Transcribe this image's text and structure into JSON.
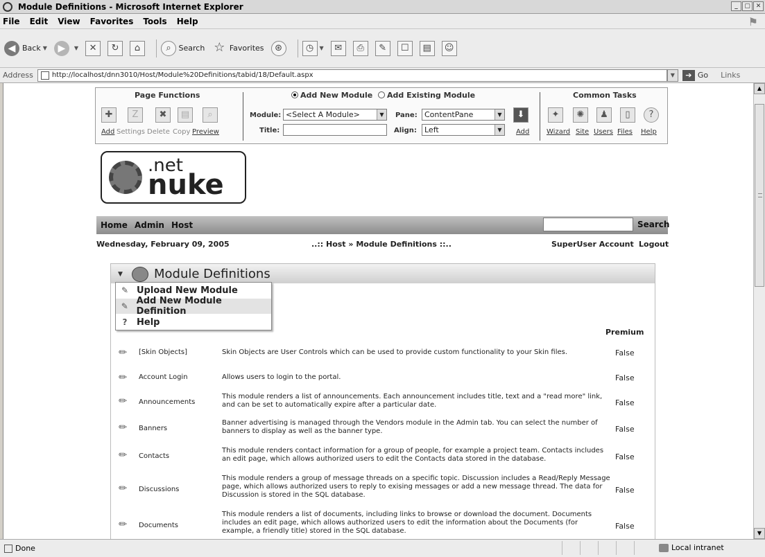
{
  "window": {
    "title": "Module Definitions - Microsoft Internet Explorer"
  },
  "menu": [
    "File",
    "Edit",
    "View",
    "Favorites",
    "Tools",
    "Help"
  ],
  "toolbar": {
    "back": "Back",
    "search": "Search",
    "favorites": "Favorites"
  },
  "address": {
    "label": "Address",
    "url": "http://localhost/dnn3010/Host/Module%20Definitions/tabid/18/Default.aspx",
    "go": "Go",
    "links": "Links"
  },
  "control_panel": {
    "page_functions": {
      "title": "Page Functions",
      "items": [
        "Add",
        "Settings",
        "Delete",
        "Copy",
        "Preview"
      ]
    },
    "add_module": {
      "radio_new": "Add New Module",
      "radio_existing": "Add Existing Module",
      "module_label": "Module:",
      "module_value": "<Select A Module>",
      "pane_label": "Pane:",
      "pane_value": "ContentPane",
      "title_label": "Title:",
      "title_value": "",
      "align_label": "Align:",
      "align_value": "Left",
      "add_link": "Add"
    },
    "common_tasks": {
      "title": "Common Tasks",
      "items": [
        "Wizard",
        "Site",
        "Users",
        "Files",
        "Help"
      ]
    }
  },
  "logo": {
    "top": ".net",
    "bottom": "nuke"
  },
  "nav": {
    "items": [
      "Home",
      "Admin",
      "Host"
    ],
    "search_button": "Search",
    "search_value": ""
  },
  "info": {
    "date": "Wednesday, February 09, 2005",
    "breadcrumb": "..:: Host » Module Definitions ::..",
    "account": "SuperUser Account",
    "logout": "Logout"
  },
  "module": {
    "title": "Module Definitions",
    "menu": [
      "Upload New Module",
      "Add New Module Definition",
      "Help"
    ],
    "premium_header": "Premium",
    "rows": [
      {
        "name": "[Skin Objects]",
        "desc": "Skin Objects are User Controls which can be used to provide custom functionality to your Skin files.",
        "premium": "False"
      },
      {
        "name": "Account Login",
        "desc": "Allows users to login to the portal.",
        "premium": "False"
      },
      {
        "name": "Announcements",
        "desc": "This module renders a list of announcements. Each announcement includes title, text and a \"read more\" link, and can be set to automatically expire after a particular date.",
        "premium": "False"
      },
      {
        "name": "Banners",
        "desc": "Banner advertising is managed through the Vendors module in the Admin tab. You can select the number of banners to display as well as the banner type.",
        "premium": "False"
      },
      {
        "name": "Contacts",
        "desc": "This module renders contact information for a group of people, for example a project team. Contacts includes an edit page, which allows authorized users to edit the Contacts data stored in the database.",
        "premium": "False"
      },
      {
        "name": "Discussions",
        "desc": "This module renders a group of message threads on a specific topic. Discussion includes a Read/Reply Message page, which allows authorized users to reply to exising messages or add a new message thread. The data for Discussion is stored in the SQL database.",
        "premium": "False"
      },
      {
        "name": "Documents",
        "desc": "This module renders a list of documents, including links to browse or download the document. Documents includes an edit page, which allows authorized users to edit the information about the Documents (for example, a friendly title) stored in the SQL database.",
        "premium": "False"
      }
    ]
  },
  "status": {
    "text": "Done",
    "zone": "Local intranet"
  }
}
